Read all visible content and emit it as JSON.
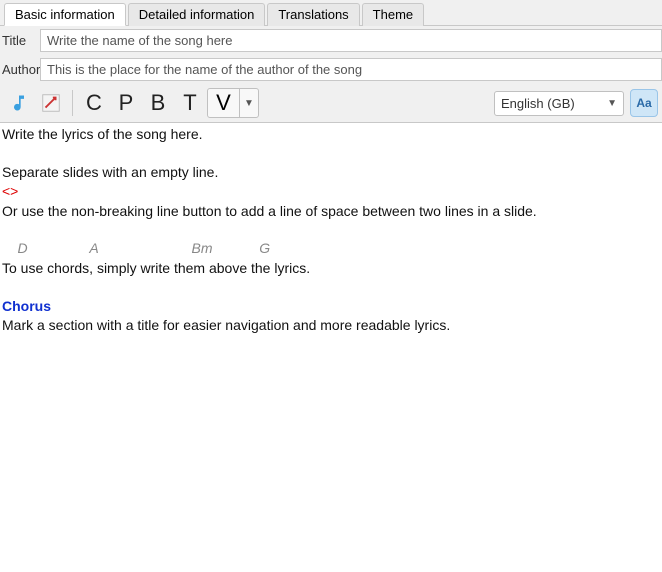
{
  "tabs": [
    {
      "label": "Basic information",
      "active": true
    },
    {
      "label": "Detailed information",
      "active": false
    },
    {
      "label": "Translations",
      "active": false
    },
    {
      "label": "Theme",
      "active": false
    }
  ],
  "fields": {
    "title_label": "Title",
    "title_value": "Write the name of the song here",
    "author_label": "Author",
    "author_value": "This is the place for the name of the author of the song"
  },
  "toolbar": {
    "letters": [
      "C",
      "P",
      "B",
      "T"
    ],
    "v_letter": "V",
    "language": "English (GB)",
    "font_btn": "Aa"
  },
  "editor": {
    "line1": "Write the lyrics of the song here.",
    "line2": "Separate slides with an empty line.",
    "nb_marker": "<>",
    "line3": "Or use the non-breaking line button to add a line of space between two lines in a slide.",
    "chords_line": "    D                A                        Bm            G",
    "line4": "To use chords, simply write them above the lyrics.",
    "section": "Chorus",
    "line5": "Mark a section with a title for easier navigation and more readable lyrics."
  }
}
